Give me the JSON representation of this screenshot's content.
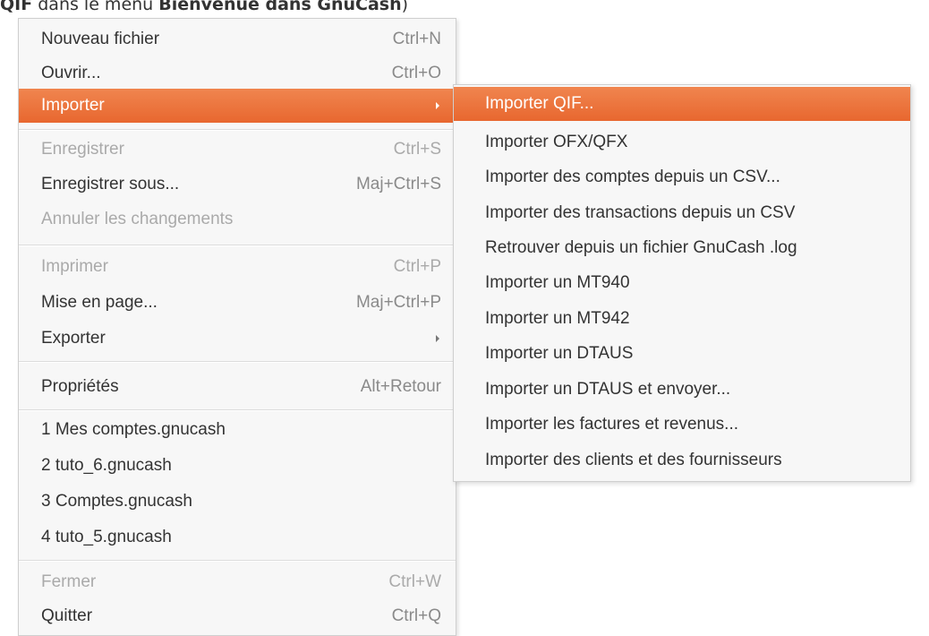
{
  "caption": {
    "prefix": "QIF",
    "middle": " dans le menu ",
    "bold": "Bienvenue dans GnuCash",
    "suffix": ")"
  },
  "menu": {
    "items": [
      {
        "label": "Nouveau fichier",
        "accel": "Ctrl+N",
        "disabled": false
      },
      {
        "label": "Ouvrir...",
        "accel": "Ctrl+O",
        "disabled": false
      },
      {
        "label": "Importer",
        "accel": "",
        "submenu": true,
        "highlighted": true
      },
      {
        "label": "Enregistrer",
        "accel": "Ctrl+S",
        "disabled": true
      },
      {
        "label": "Enregistrer sous...",
        "accel": "Maj+Ctrl+S",
        "disabled": false
      },
      {
        "label": "Annuler les changements",
        "accel": "",
        "disabled": true
      },
      {
        "label": "Imprimer",
        "accel": "Ctrl+P",
        "disabled": true
      },
      {
        "label": "Mise en page...",
        "accel": "Maj+Ctrl+P",
        "disabled": false
      },
      {
        "label": "Exporter",
        "accel": "",
        "submenu": true
      },
      {
        "label": "Propriétés",
        "accel": "Alt+Retour",
        "disabled": false
      },
      {
        "label": "1 Mes comptes.gnucash",
        "accel": ""
      },
      {
        "label": "2 tuto_6.gnucash",
        "accel": ""
      },
      {
        "label": "3 Comptes.gnucash",
        "accel": ""
      },
      {
        "label": "4 tuto_5.gnucash",
        "accel": ""
      },
      {
        "label": "Fermer",
        "accel": "Ctrl+W",
        "disabled": true
      },
      {
        "label": "Quitter",
        "accel": "Ctrl+Q",
        "disabled": false
      }
    ]
  },
  "submenu": {
    "items": [
      {
        "label": "Importer QIF...",
        "highlighted": true
      },
      {
        "label": "Importer OFX/QFX"
      },
      {
        "label": "Importer des comptes depuis un CSV..."
      },
      {
        "label": "Importer des transactions depuis un CSV"
      },
      {
        "label": "Retrouver depuis un fichier GnuCash .log"
      },
      {
        "label": "Importer un MT940"
      },
      {
        "label": "Importer un MT942"
      },
      {
        "label": "Importer un DTAUS"
      },
      {
        "label": "Importer un DTAUS et envoyer..."
      },
      {
        "label": "Importer les factures et revenus..."
      },
      {
        "label": "Importer des clients et des fournisseurs"
      }
    ]
  },
  "colors": {
    "highlight": "#e8672f",
    "menu_background": "#f7f7f7",
    "disabled_text": "#aaaaaa"
  }
}
